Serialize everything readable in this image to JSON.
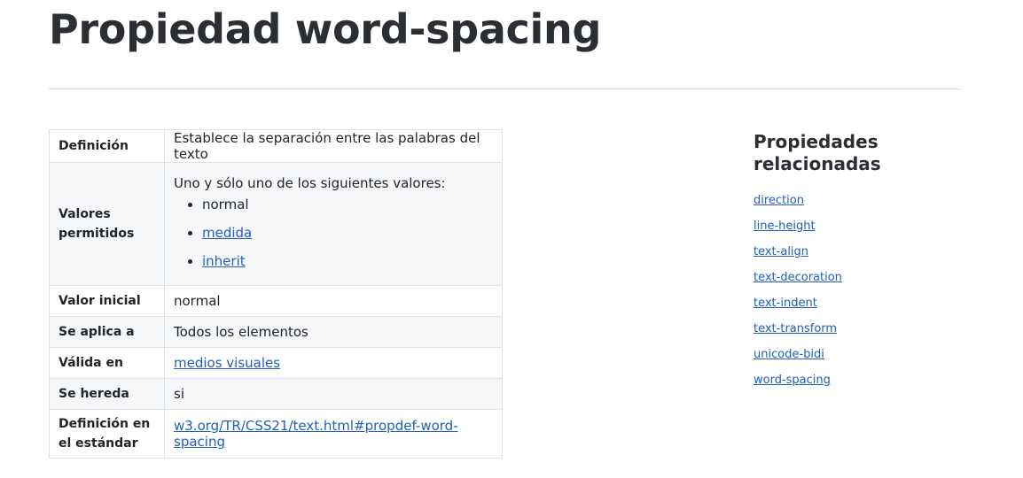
{
  "title": "Propiedad word-spacing",
  "table": {
    "definition": {
      "label": "Definición",
      "value": "Establece la separación entre las palabras del texto"
    },
    "allowed_values": {
      "label": "Valores permitidos",
      "intro": "Uno y sólo uno de los siguientes valores:",
      "items": [
        {
          "text": "normal",
          "is_link": false
        },
        {
          "text": "medida",
          "is_link": true
        },
        {
          "text": "inherit",
          "is_link": true
        }
      ]
    },
    "initial_value": {
      "label": "Valor inicial",
      "value": "normal"
    },
    "applies_to": {
      "label": "Se aplica a",
      "value": "Todos los elementos"
    },
    "valid_in": {
      "label": "Válida en",
      "value": "medios visuales"
    },
    "inherited": {
      "label": "Se hereda",
      "value": "si"
    },
    "standard": {
      "label": "Definición en el estándar",
      "value": "w3.org/TR/CSS21/text.html#propdef-word-spacing"
    }
  },
  "related": {
    "heading": "Propiedades relacionadas",
    "links": [
      "direction",
      "line-height",
      "text-align",
      "text-decoration",
      "text-indent",
      "text-transform",
      "unicode-bidi",
      "word-spacing"
    ]
  },
  "colors": {
    "link": "#1f5fbf",
    "text": "#212529",
    "row_alt": "#f6f7f8",
    "border": "#dee2e6"
  }
}
